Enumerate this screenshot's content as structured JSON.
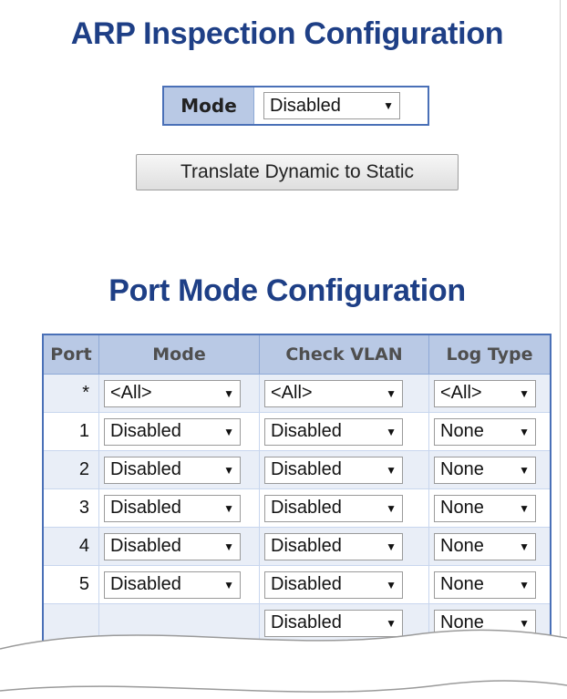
{
  "page": {
    "title": "ARP Inspection Configuration",
    "section_title": "Port Mode Configuration"
  },
  "global": {
    "mode_label": "Mode",
    "mode_value": "Disabled",
    "translate_button": "Translate Dynamic to Static"
  },
  "table": {
    "headers": [
      "Port",
      "Mode",
      "Check VLAN",
      "Log Type"
    ],
    "rows": [
      {
        "port": "*",
        "mode": "<All>",
        "check_vlan": "<All>",
        "log_type": "<All>"
      },
      {
        "port": "1",
        "mode": "Disabled",
        "check_vlan": "Disabled",
        "log_type": "None"
      },
      {
        "port": "2",
        "mode": "Disabled",
        "check_vlan": "Disabled",
        "log_type": "None"
      },
      {
        "port": "3",
        "mode": "Disabled",
        "check_vlan": "Disabled",
        "log_type": "None"
      },
      {
        "port": "4",
        "mode": "Disabled",
        "check_vlan": "Disabled",
        "log_type": "None"
      },
      {
        "port": "5",
        "mode": "Disabled",
        "check_vlan": "Disabled",
        "log_type": "None"
      },
      {
        "port": "",
        "mode": "",
        "check_vlan": "Disabled",
        "log_type": "None"
      }
    ]
  },
  "icons": {
    "dropdown": "triangle-down-icon"
  },
  "colors": {
    "title": "#1e3f86",
    "header_bg": "#b9c9e5",
    "border": "#4a70b7",
    "alt_row": "#e9eef7"
  }
}
